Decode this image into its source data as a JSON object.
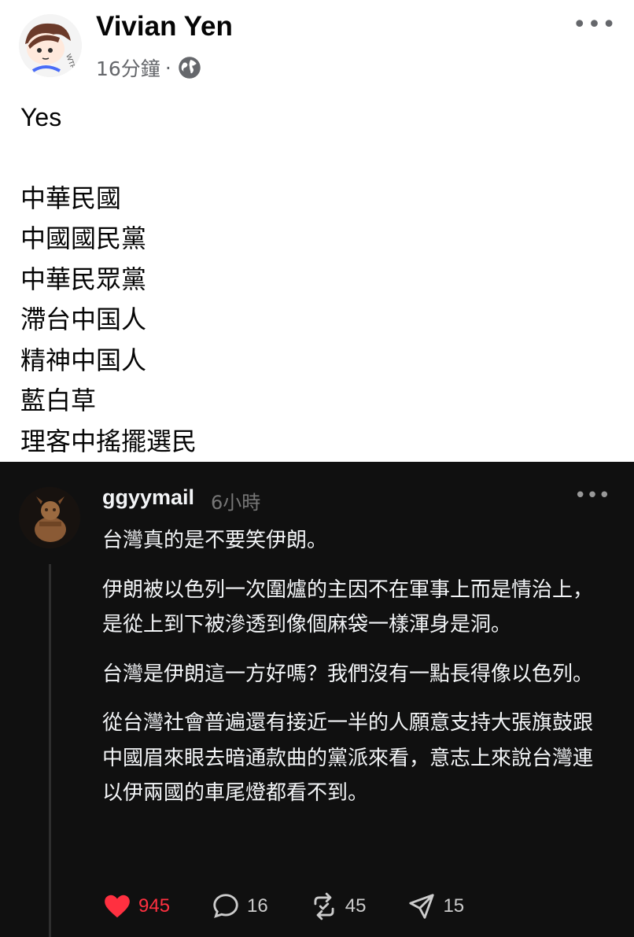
{
  "facebook_post": {
    "author": "Vivian Yen",
    "time": "16分鐘",
    "separator": "·",
    "audience_icon": "globe-icon",
    "more_icon": "more-horizontal-icon",
    "more_label": "•••",
    "avatar_label": "WTF",
    "lines": [
      "Yes",
      "",
      "中華民國",
      "中國國民黨",
      "中華民眾黨",
      "滯台中国人",
      "精神中国人",
      "藍白草",
      "理客中搖擺選民"
    ]
  },
  "threads_post": {
    "username": "ggyymail",
    "time": "6小時",
    "more_label": "•••",
    "paragraphs": [
      "台灣真的是不要笑伊朗。",
      "伊朗被以色列一次圍爐的主因不在軍事上而是情治上，\n是從上到下被滲透到像個麻袋一樣渾身是洞。",
      "台灣是伊朗這一方好嗎？我們沒有一點長得像以色列。",
      "從台灣社會普遍還有接近一半的人願意支持大張旗鼓跟中國眉來眼去暗通款曲的黨派來看，意志上來說台灣連以伊兩國的車尾燈都看不到。"
    ],
    "actions": {
      "likes": "945",
      "comments": "16",
      "reposts": "45",
      "shares": "15"
    },
    "colors": {
      "background": "#101010",
      "like": "#ff3040",
      "text": "#f3f5f7",
      "muted": "#777777"
    }
  }
}
